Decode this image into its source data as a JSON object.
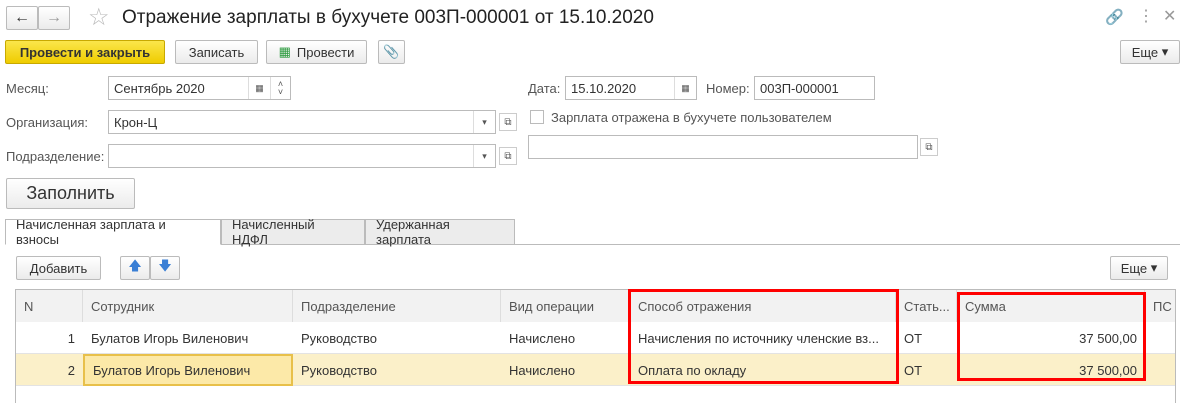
{
  "title": "Отражение зарплаты в бухучете 003П-000001 от 15.10.2020",
  "toolbar": {
    "post_close": "Провести и закрыть",
    "save": "Записать",
    "post": "Провести",
    "more": "Еще"
  },
  "form": {
    "month_label": "Месяц:",
    "month_value": "Сентябрь 2020",
    "date_label": "Дата:",
    "date_value": "15.10.2020",
    "number_label": "Номер:",
    "number_value": "003П-000001",
    "org_label": "Организация:",
    "org_value": "Крон-Ц",
    "sub_label": "Подразделение:",
    "sub_value": "",
    "checkbox_label": "Зарплата отражена в бухучете пользователем",
    "fill_button": "Заполнить"
  },
  "tabs": [
    "Начисленная зарплата и взносы",
    "Начисленный НДФЛ",
    "Удержанная зарплата"
  ],
  "table_toolbar": {
    "add": "Добавить",
    "more": "Еще"
  },
  "table": {
    "columns": [
      "N",
      "Сотрудник",
      "Подразделение",
      "Вид операции",
      "Способ отражения",
      "Стать...",
      "Сумма",
      "ПС"
    ],
    "rows": [
      [
        "1",
        "Булатов Игорь Виленович",
        "Руководство",
        "Начислено",
        "Начисления по источнику членские вз...",
        "ОТ",
        "37 500,00"
      ],
      [
        "2",
        "Булатов Игорь Виленович",
        "Руководство",
        "Начислено",
        "Оплата по окладу",
        "ОТ",
        "37 500,00"
      ]
    ]
  },
  "colors": {
    "primary": "#f5d60f",
    "selected_row": "#fbf0c9",
    "highlight": "#ff0000"
  }
}
